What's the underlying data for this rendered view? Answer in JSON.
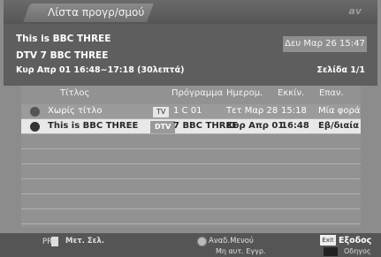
{
  "header": {
    "title": "Λίστα προγρ/σμού",
    "logo": "av"
  },
  "info": {
    "program_title": "This is BBC THREE",
    "channel": "DTV 7 BBC THREE",
    "time_range": "Κυρ Απρ 01 16:48~17:18 (30λεπτά)",
    "current_datetime": "Δευ Μαρ 26 15:47",
    "page": "Σελίδα 1/1"
  },
  "table": {
    "headers": [
      "Τίτλος",
      "Πρόγραμμα",
      "Ημερομ.",
      "Εκκίν.",
      "Επαν."
    ],
    "rows": [
      {
        "title": "Χωρίς τίτλο",
        "badge": "TV",
        "program": "1 C 01",
        "date": "Τετ Μαρ 28",
        "start": "15:18",
        "repeat": "Μία φορά"
      },
      {
        "title": "This is BBC THREE",
        "badge": "DTV",
        "program": "7 BBC THREE",
        "date": "Κυρ Απρ 01",
        "start": "16:48",
        "repeat": "Εβ/διαία"
      }
    ]
  },
  "footer": {
    "pr_label": "PR",
    "page_move": "Μετ. Σελ.",
    "sub_menu": "Αναδ.Μενού",
    "cancel_record": "Μη αυτ. Εγγρ.",
    "exit_key": "Exit",
    "exit_label": "Εξοδος",
    "guide_label": "Οδηγος"
  }
}
